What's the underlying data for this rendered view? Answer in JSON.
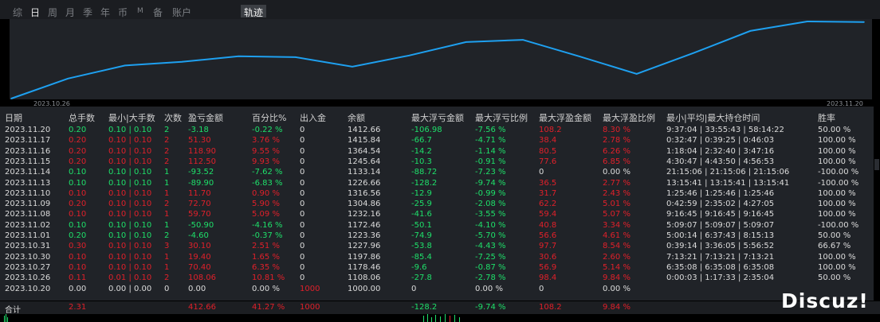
{
  "tabs": [
    "综",
    "日",
    "周",
    "月",
    "季",
    "年",
    "币",
    "M",
    "备",
    "账户"
  ],
  "active_tab_index": 1,
  "trajectory_tab": "轨迹",
  "chart_data": {
    "type": "line",
    "x_start_label": "2023.10.26",
    "x_end_label": "2023.11.20",
    "categories": [
      "2023.10.20",
      "2023.10.26",
      "2023.10.27",
      "2023.10.30",
      "2023.10.31",
      "2023.11.01",
      "2023.11.02",
      "2023.11.08",
      "2023.11.09",
      "2023.11.10",
      "2023.11.13",
      "2023.11.14",
      "2023.11.15",
      "2023.11.16",
      "2023.11.17",
      "2023.11.20"
    ],
    "values": [
      1000.0,
      1108.06,
      1178.46,
      1197.86,
      1227.96,
      1223.36,
      1172.46,
      1232.16,
      1304.86,
      1316.56,
      1226.68,
      1133.14,
      1245.64,
      1364.54,
      1415.84,
      1412.66
    ],
    "ylim": [
      1000,
      1420
    ],
    "color": "#1ea0f0",
    "grid": false
  },
  "table": {
    "headers": [
      "日期",
      "总手数",
      "最小|大手数",
      "次数",
      "盈亏金额",
      "百分比%",
      "出入金",
      "余额",
      "最大浮亏金额",
      "最大浮亏比例",
      "最大浮盈金额",
      "最大浮盈比例",
      "最小|平均|最大持仓时间",
      "胜率"
    ],
    "rows": [
      {
        "cells": [
          "2023.11.20",
          "0.20",
          "0.10 | 0.10",
          "2",
          "-3.18",
          "-0.22 %",
          "0",
          "1412.66",
          "-106.98",
          "-7.56 %",
          "108.2",
          "8.30 %",
          "9:37:04 | 33:55:43 | 58:14:22",
          "50.00 %"
        ],
        "color": "green"
      },
      {
        "cells": [
          "2023.11.17",
          "0.20",
          "0.10 | 0.10",
          "2",
          "51.30",
          "3.76 %",
          "0",
          "1415.84",
          "-66.7",
          "-4.71 %",
          "38.4",
          "2.78 %",
          "0:32:47 | 0:39:25 | 0:46:03",
          "100.00 %"
        ],
        "color": "red"
      },
      {
        "cells": [
          "2023.11.16",
          "0.20",
          "0.10 | 0.10",
          "2",
          "118.90",
          "9.55 %",
          "0",
          "1364.54",
          "-14.2",
          "-1.14 %",
          "80.5",
          "6.26 %",
          "1:18:04 | 2:32:40 | 3:47:16",
          "100.00 %"
        ],
        "color": "red"
      },
      {
        "cells": [
          "2023.11.15",
          "0.20",
          "0.10 | 0.10",
          "2",
          "112.50",
          "9.93 %",
          "0",
          "1245.64",
          "-10.3",
          "-0.91 %",
          "77.6",
          "6.85 %",
          "4:30:47 | 4:43:50 | 4:56:53",
          "100.00 %"
        ],
        "color": "red"
      },
      {
        "cells": [
          "2023.11.14",
          "0.10",
          "0.10 | 0.10",
          "1",
          "-93.52",
          "-7.62 %",
          "0",
          "1133.14",
          "-88.72",
          "-7.23 %",
          "0",
          "0.00 %",
          "21:15:06 | 21:15:06 | 21:15:06",
          "-100.00 %"
        ],
        "color": "green"
      },
      {
        "cells": [
          "2023.11.13",
          "0.10",
          "0.10 | 0.10",
          "1",
          "-89.90",
          "-6.83 %",
          "0",
          "1226.66",
          "-128.2",
          "-9.74 %",
          "36.5",
          "2.77 %",
          "13:15:41 | 13:15:41 | 13:15:41",
          "-100.00 %"
        ],
        "color": "green"
      },
      {
        "cells": [
          "2023.11.10",
          "0.10",
          "0.10 | 0.10",
          "1",
          "11.70",
          "0.90 %",
          "0",
          "1316.56",
          "-12.9",
          "-0.99 %",
          "31.7",
          "2.43 %",
          "1:25:46 | 1:25:46 | 1:25:46",
          "100.00 %"
        ],
        "color": "red"
      },
      {
        "cells": [
          "2023.11.09",
          "0.20",
          "0.10 | 0.10",
          "2",
          "72.70",
          "5.90 %",
          "0",
          "1304.86",
          "-25.9",
          "-2.08 %",
          "62.2",
          "5.01 %",
          "0:42:59 | 2:35:02 | 4:27:05",
          "100.00 %"
        ],
        "color": "red"
      },
      {
        "cells": [
          "2023.11.08",
          "0.10",
          "0.10 | 0.10",
          "1",
          "59.70",
          "5.09 %",
          "0",
          "1232.16",
          "-41.6",
          "-3.55 %",
          "59.4",
          "5.07 %",
          "9:16:45 | 9:16:45 | 9:16:45",
          "100.00 %"
        ],
        "color": "red"
      },
      {
        "cells": [
          "2023.11.02",
          "0.10",
          "0.10 | 0.10",
          "1",
          "-50.90",
          "-4.16 %",
          "0",
          "1172.46",
          "-50.1",
          "-4.10 %",
          "40.8",
          "3.34 %",
          "5:09:07 | 5:09:07 | 5:09:07",
          "-100.00 %"
        ],
        "color": "green"
      },
      {
        "cells": [
          "2023.11.01",
          "0.20",
          "0.10 | 0.10",
          "2",
          "-4.60",
          "-0.37 %",
          "0",
          "1223.36",
          "-74.9",
          "-5.70 %",
          "56.6",
          "4.61 %",
          "5:00:14 | 6:37:43 | 8:15:13",
          "50.00 %"
        ],
        "color": "green"
      },
      {
        "cells": [
          "2023.10.31",
          "0.30",
          "0.10 | 0.10",
          "3",
          "30.10",
          "2.51 %",
          "0",
          "1227.96",
          "-53.8",
          "-4.43 %",
          "97.7",
          "8.54 %",
          "0:39:14 | 3:36:05 | 5:56:52",
          "66.67 %"
        ],
        "color": "red"
      },
      {
        "cells": [
          "2023.10.30",
          "0.10",
          "0.10 | 0.10",
          "1",
          "19.40",
          "1.65 %",
          "0",
          "1197.86",
          "-85.4",
          "-7.25 %",
          "30.6",
          "2.60 %",
          "7:13:21 | 7:13:21 | 7:13:21",
          "100.00 %"
        ],
        "color": "red"
      },
      {
        "cells": [
          "2023.10.27",
          "0.10",
          "0.10 | 0.10",
          "1",
          "70.40",
          "6.35 %",
          "0",
          "1178.46",
          "-9.6",
          "-0.87 %",
          "56.9",
          "5.14 %",
          "6:35:08 | 6:35:08 | 6:35:08",
          "100.00 %"
        ],
        "color": "red"
      },
      {
        "cells": [
          "2023.10.26",
          "0.11",
          "0.01 | 0.10",
          "2",
          "108.06",
          "10.81 %",
          "0",
          "1108.06",
          "-27.8",
          "-2.78 %",
          "98.4",
          "9.84 %",
          "0:00:03 | 1:17:33 | 2:35:04",
          "50.00 %"
        ],
        "color": "red"
      },
      {
        "cells": [
          "2023.10.20",
          "0.00",
          "0.00 | 0.00",
          "0",
          "0.00",
          "0.00 %",
          "1000",
          "1000.00",
          "0",
          "0.00 %",
          "0",
          "0.00 %",
          "",
          ""
        ],
        "color": "white"
      }
    ]
  },
  "total": {
    "label": "合计",
    "total_lots": "2.31",
    "pnl": "412.66",
    "percent": "41.27 %",
    "deposit": "1000",
    "max_float_loss": "-128.2",
    "max_float_loss_pct": "-9.74 %",
    "max_float_profit": "108.2",
    "max_float_profit_pct": "9.84 %"
  },
  "watermark": "Discuz!",
  "colors": {
    "profit": "#e0202a",
    "loss": "#1ee06a",
    "line": "#1ea0f0",
    "panel": "#202328",
    "topbar": "#1b1d21"
  }
}
